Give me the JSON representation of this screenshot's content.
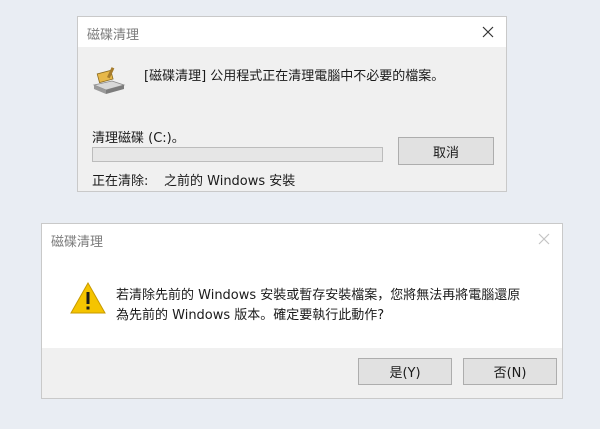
{
  "dialog1": {
    "title": "磁碟清理",
    "message": "[磁碟清理] 公用程式正在清理電腦中不必要的檔案。",
    "drive_label": "清理磁碟  (C:)。",
    "cancel_label": "取消",
    "status_prefix": "正在清除:",
    "status_item": "之前的 Windows 安裝",
    "progress": 0,
    "icon": "disk-cleanup-icon"
  },
  "dialog2": {
    "title": "磁碟清理",
    "message_line1": "若清除先前的 Windows 安裝或暫存安裝檔案，您將無法再將電腦還原",
    "message_line2": "為先前的 Windows 版本。確定要執行此動作?",
    "yes_label": "是(Y)",
    "no_label": "否(N)",
    "icon": "warning-icon"
  },
  "colors": {
    "progress_fill": "#06b025",
    "warning": "#f5c400"
  }
}
